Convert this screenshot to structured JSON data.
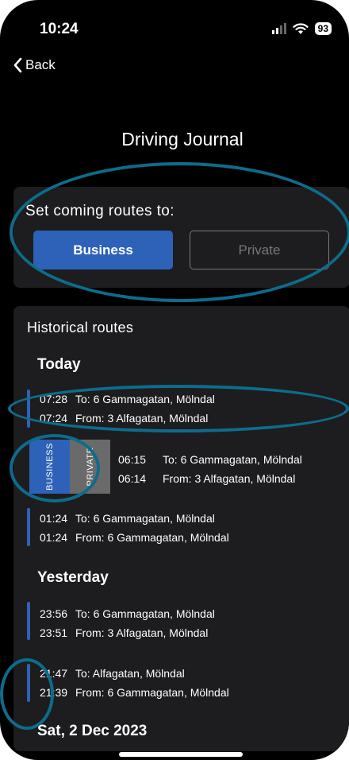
{
  "status": {
    "time": "10:24",
    "battery": "93"
  },
  "nav": {
    "back_label": "Back"
  },
  "page": {
    "title": "Driving Journal"
  },
  "route_setting": {
    "label": "Set coming routes to:",
    "business_label": "Business",
    "private_label": "Private"
  },
  "historical": {
    "title": "Historical routes",
    "day_today": "Today",
    "day_yesterday": "Yesterday",
    "day_dec2": "Sat, 2 Dec 2023",
    "groups": [
      {
        "to_time": "07:28",
        "to_dest": "To: 6 Gammagatan, Mölndal",
        "from_time": "07:24",
        "from_dest": "From: 3 Alfagatan, Mölndal"
      },
      {
        "to_time": "06:15",
        "to_dest": "To: 6 Gammagatan, Mölndal",
        "from_time": "06:14",
        "from_dest": "From: 3 Alfagatan, Mölndal"
      },
      {
        "to_time": "01:24",
        "to_dest": "To: 6 Gammagatan, Mölndal",
        "from_time": "01:24",
        "from_dest": "From: 6 Gammagatan, Mölndal"
      },
      {
        "to_time": "23:56",
        "to_dest": "To: 6 Gammagatan, Mölndal",
        "from_time": "23:51",
        "from_dest": "From: 3 Alfagatan, Mölndal"
      },
      {
        "to_time": "21:47",
        "to_dest": "To: Alfagatan, Mölndal",
        "from_time": "21:39",
        "from_dest": "From: 6 Gammagatan, Mölndal"
      }
    ],
    "swipe_business_label": "BUSINESS",
    "swipe_private_label": "PRIVATE"
  },
  "colors": {
    "accent": "#2e62b8",
    "annotation": "#0d6c8c",
    "card": "#1d1d1f"
  }
}
